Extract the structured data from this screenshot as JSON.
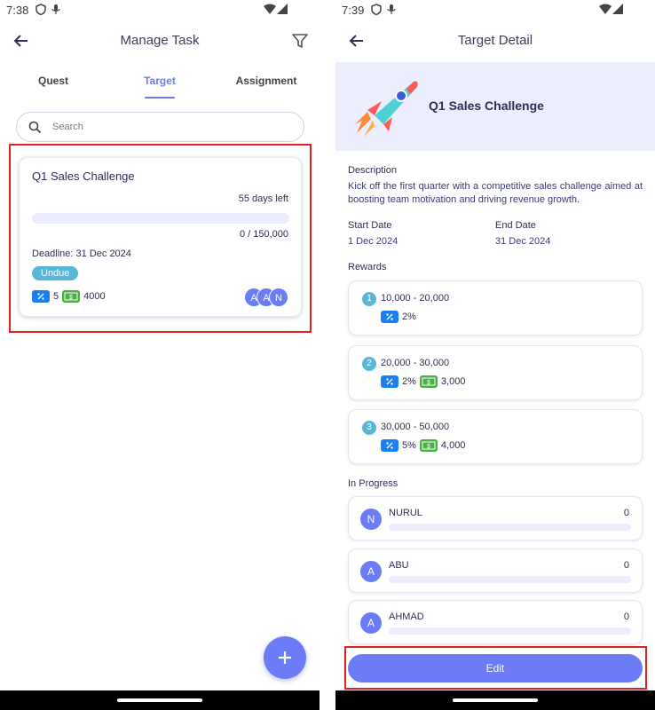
{
  "left": {
    "status_time": "7:38",
    "title": "Manage Task",
    "tabs": [
      {
        "label": "Quest"
      },
      {
        "label": "Target"
      },
      {
        "label": "Assignment"
      }
    ],
    "search_placeholder": "Search",
    "card": {
      "title": "Q1 Sales Challenge",
      "days_left": "55 days left",
      "progress_fraction": 0,
      "progress_text": "0 / 150,000",
      "deadline": "Deadline: 31 Dec 2024",
      "status_badge": "Undue",
      "reward_percent_count": "5",
      "reward_cash": "4000",
      "avatars": [
        "A",
        "A",
        "N"
      ]
    },
    "fab_icon": "plus-icon"
  },
  "right": {
    "status_time": "7:39",
    "title": "Target Detail",
    "target_title": "Q1 Sales Challenge",
    "description_label": "Description",
    "description": "Kick off the first quarter with a competitive sales challenge aimed at boosting team motivation and driving revenue growth.",
    "start_label": "Start Date",
    "start_value": "1 Dec 2024",
    "end_label": "End Date",
    "end_value": "31 Dec 2024",
    "rewards_label": "Rewards",
    "rewards": [
      {
        "num": "1",
        "range": "10,000 - 20,000",
        "percent": "2%",
        "cash": ""
      },
      {
        "num": "2",
        "range": "20,000 - 30,000",
        "percent": "2%",
        "cash": "3,000"
      },
      {
        "num": "3",
        "range": "30,000 - 50,000",
        "percent": "5%",
        "cash": "4,000"
      }
    ],
    "in_progress_label": "In Progress",
    "members": [
      {
        "initial": "N",
        "name": "NURUL",
        "value": "0",
        "progress_fraction": 0
      },
      {
        "initial": "A",
        "name": "ABU",
        "value": "0",
        "progress_fraction": 0
      },
      {
        "initial": "A",
        "name": "AHMAD",
        "value": "0",
        "progress_fraction": 0
      }
    ],
    "edit_label": "Edit"
  },
  "colors": {
    "accent": "#6b7cf6",
    "badge": "#59b6d6",
    "highlight": "#e0211f",
    "percent_icon": "#1b7ff0",
    "cash_icon": "#4aae48"
  }
}
